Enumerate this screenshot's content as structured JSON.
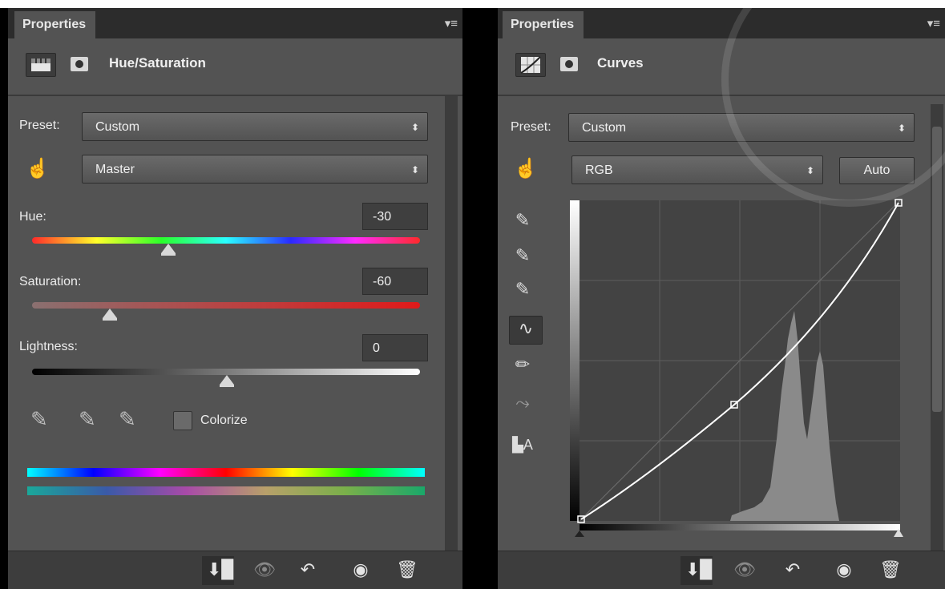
{
  "left_panel": {
    "tab": "Properties",
    "title": "Hue/Saturation",
    "preset_label": "Preset:",
    "preset_value": "Custom",
    "channel_value": "Master",
    "hue": {
      "label": "Hue:",
      "value": "-30",
      "position": 0.35
    },
    "saturation": {
      "label": "Saturation:",
      "value": "-60",
      "position": 0.2
    },
    "lightness": {
      "label": "Lightness:",
      "value": "0",
      "position": 0.5
    },
    "colorize_label": "Colorize",
    "colorize_checked": false,
    "icons": [
      "adjustment-icon",
      "mask-icon",
      "target-adjust-icon",
      "eyedropper-icon",
      "eyedropper-add-icon",
      "eyedropper-subtract-icon"
    ]
  },
  "right_panel": {
    "tab": "Properties",
    "title": "Curves",
    "preset_label": "Preset:",
    "preset_value": "Custom",
    "channel_value": "RGB",
    "auto_label": "Auto",
    "tools": [
      "target-adjust-icon",
      "black-point-eyedropper-icon",
      "gray-point-eyedropper-icon",
      "white-point-eyedropper-icon",
      "curve-point-icon",
      "pencil-icon",
      "smooth-icon",
      "clipping-warning-icon"
    ],
    "curve_points": [
      {
        "input": 0,
        "output": 0
      },
      {
        "input": 49,
        "output": 37
      },
      {
        "input": 100,
        "output": 100
      }
    ]
  },
  "bottom_icons": [
    "clip-to-layer-icon",
    "view-previous-icon",
    "reset-icon",
    "visibility-eye-icon",
    "trash-icon"
  ],
  "colors": {
    "panel": "#535353",
    "dark": "#3d3d3d",
    "text": "#f0f0f0"
  }
}
